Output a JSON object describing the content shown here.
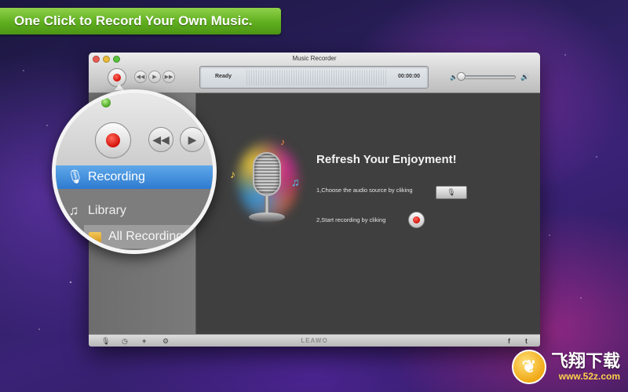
{
  "banner": {
    "text": "One Click to Record Your Own Music."
  },
  "window": {
    "title": "Music Recorder"
  },
  "toolbar": {
    "status": "Ready",
    "time": "00:00:00",
    "volume_level": 0.0
  },
  "main": {
    "headline": "Refresh Your Enjoyment!",
    "step1": "1,Choose the audio source by cliking",
    "step2": "2,Start recording by cliking"
  },
  "sidebar": {
    "items": [
      {
        "label": "Recording",
        "icon": "microphone-icon",
        "selected": true
      },
      {
        "label": "Library",
        "icon": "music-note-icon",
        "selected": false
      },
      {
        "label": "All Recording",
        "icon": "folder-icon",
        "selected": false
      }
    ]
  },
  "bottombar": {
    "brand": "LEAWO",
    "left_icons": [
      "microphone-icon",
      "clock-icon",
      "plus-icon",
      "gear-icon"
    ],
    "right_icons": [
      "facebook-icon",
      "twitter-icon"
    ]
  },
  "watermark": {
    "title": "飞翔下载",
    "url": "www.52z.com"
  },
  "colors": {
    "banner_green": "#5fae1f",
    "record_red": "#d3100a",
    "selection_blue": "#2e7bd0"
  }
}
